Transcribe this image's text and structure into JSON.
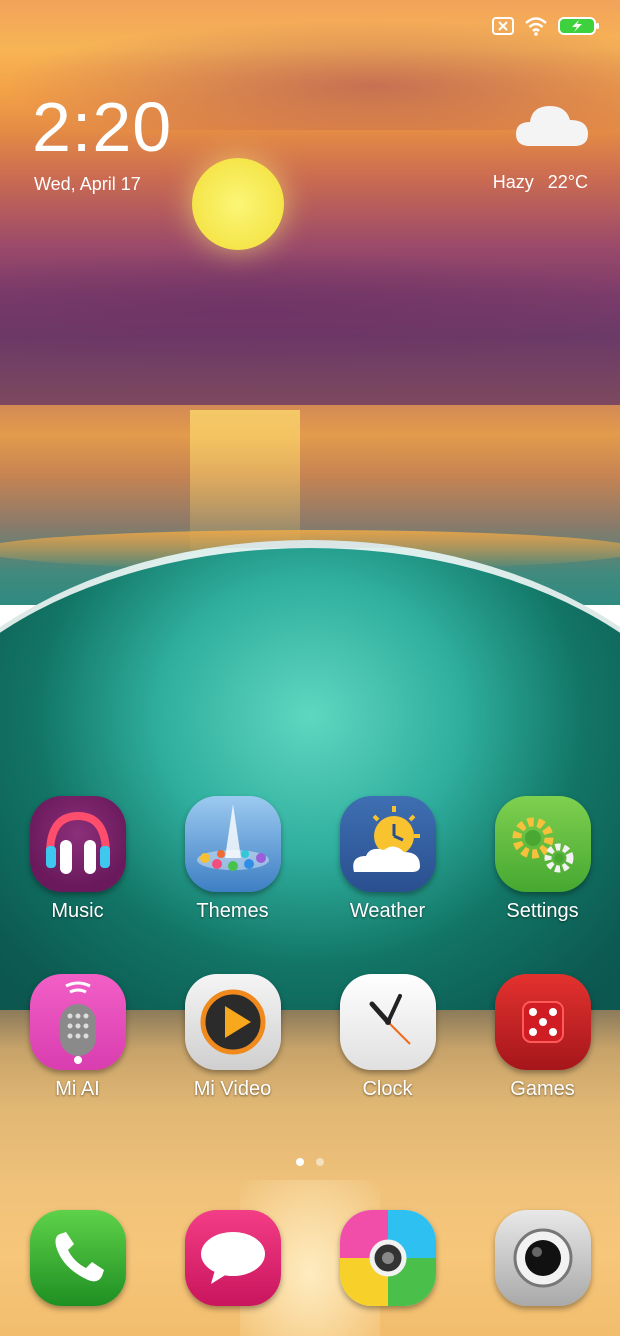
{
  "status_bar": {
    "icons": [
      "no-sim-icon",
      "wifi-icon",
      "battery-charging-icon"
    ]
  },
  "clock_widget": {
    "time": "2:20",
    "date": "Wed, April 17"
  },
  "weather_widget": {
    "condition": "Hazy",
    "temperature": "22°C",
    "icon": "cloud-icon"
  },
  "apps_row1": [
    {
      "label": "Music",
      "icon": "music-icon"
    },
    {
      "label": "Themes",
      "icon": "themes-icon"
    },
    {
      "label": "Weather",
      "icon": "weather-icon"
    },
    {
      "label": "Settings",
      "icon": "settings-icon"
    }
  ],
  "apps_row2": [
    {
      "label": "Mi AI",
      "icon": "mi-ai-icon"
    },
    {
      "label": "Mi Video",
      "icon": "mi-video-icon"
    },
    {
      "label": "Clock",
      "icon": "clock-icon"
    },
    {
      "label": "Games",
      "icon": "games-icon"
    }
  ],
  "page_indicator": {
    "pages": 2,
    "current": 1
  },
  "dock": [
    {
      "icon": "phone-icon"
    },
    {
      "icon": "messages-icon"
    },
    {
      "icon": "gallery-icon"
    },
    {
      "icon": "camera-icon"
    }
  ]
}
